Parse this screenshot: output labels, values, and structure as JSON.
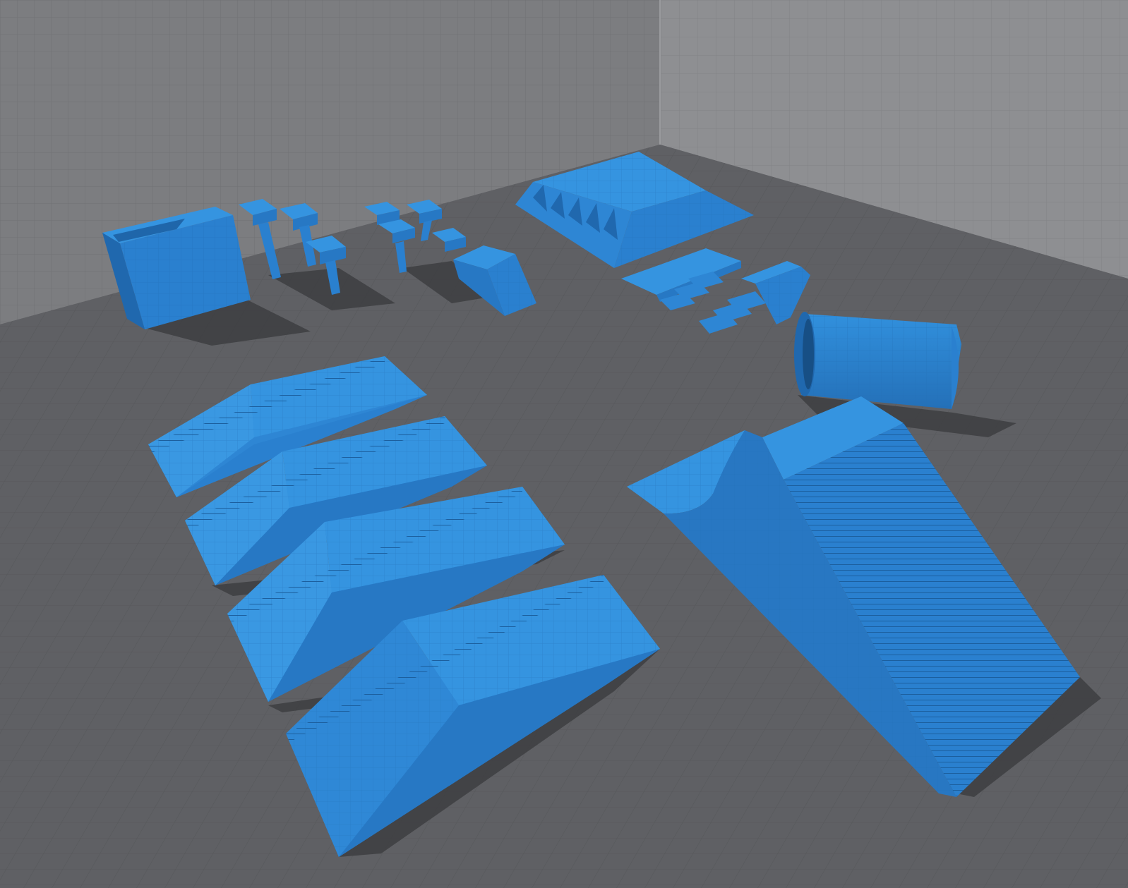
{
  "scene": {
    "colors": {
      "floor": "#5f6064",
      "floor_grid": "#55565a",
      "wall_left": "#7d7e81",
      "wall_right": "#8f9093",
      "wall_grid": "#727376",
      "obstacle_top": "#2f8ad8",
      "obstacle_side": "#2778c4",
      "obstacle_front": "#2a80cf",
      "obstacle_dark": "#1f66aa",
      "shadow": "#3c3d40"
    },
    "objects": [
      {
        "name": "box-ledge",
        "kind": "box"
      },
      {
        "name": "t-posts-left",
        "kind": "posts",
        "count": 3
      },
      {
        "name": "t-posts-right",
        "kind": "posts",
        "count": 4
      },
      {
        "name": "small-wedge",
        "kind": "wedge"
      },
      {
        "name": "pyramid-platform",
        "kind": "platform"
      },
      {
        "name": "step-blocks",
        "kind": "stairs"
      },
      {
        "name": "half-pipe-tube",
        "kind": "tube"
      },
      {
        "name": "stair-ramp-1",
        "kind": "stair-ramp"
      },
      {
        "name": "stair-ramp-2",
        "kind": "stair-ramp"
      },
      {
        "name": "stair-ramp-3",
        "kind": "stair-ramp"
      },
      {
        "name": "stair-ramp-4",
        "kind": "stair-ramp"
      },
      {
        "name": "quarter-pipe-stairs",
        "kind": "quarter-pipe"
      }
    ]
  }
}
